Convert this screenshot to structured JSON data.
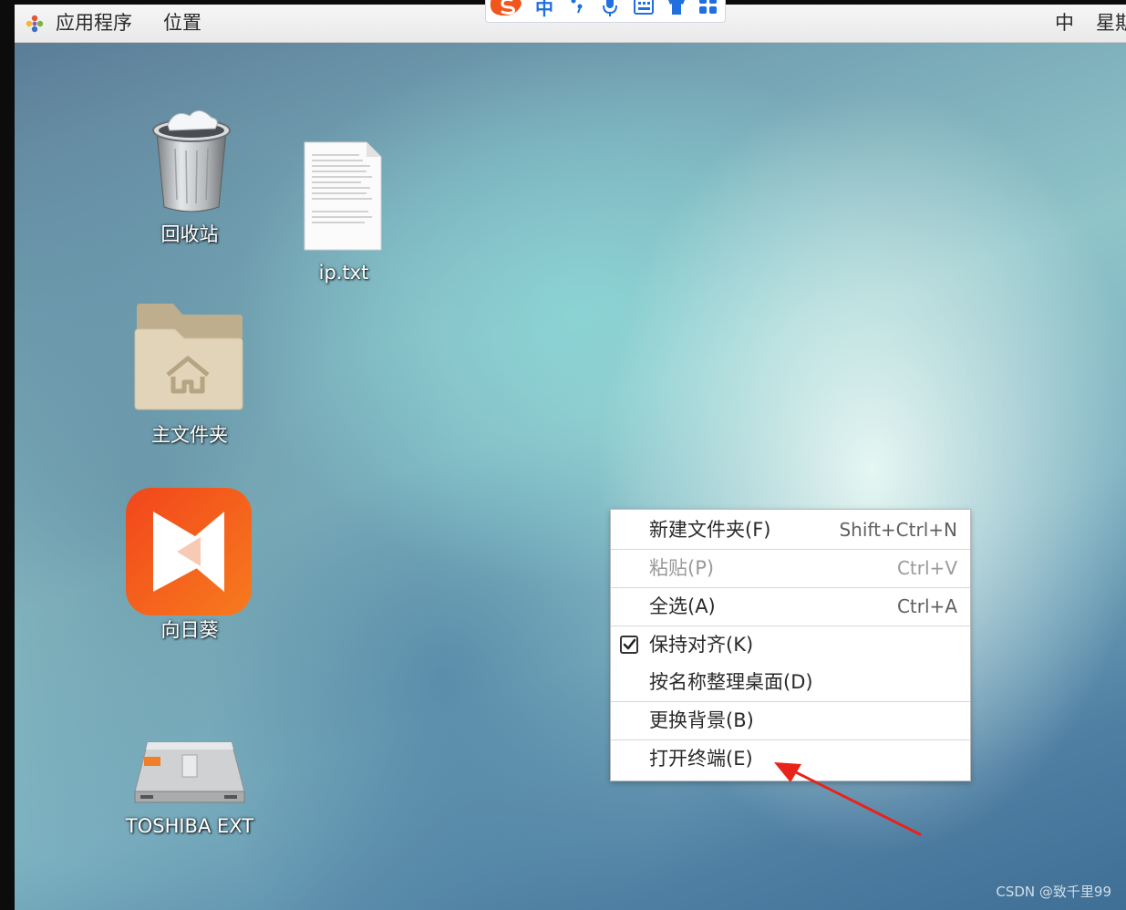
{
  "top_panel": {
    "applications_label": "应用程序",
    "places_label": "位置",
    "input_method_label": "中",
    "clock_label": "星期"
  },
  "ime_toolbar": {
    "mode_label": "中"
  },
  "desktop": {
    "icons": [
      {
        "label": "回收站",
        "icon": "trash-icon"
      },
      {
        "label": "ip.txt",
        "icon": "text-file-icon"
      },
      {
        "label": "主文件夹",
        "icon": "home-folder-icon"
      },
      {
        "label": "向日葵",
        "icon": "sunlogin-app-icon"
      },
      {
        "label": "TOSHIBA EXT",
        "icon": "external-drive-icon"
      }
    ]
  },
  "context_menu": {
    "items": [
      {
        "label": "新建文件夹(F)",
        "mnemonic": "F",
        "shortcut": "Shift+Ctrl+N",
        "enabled": true
      },
      {
        "label": "粘贴(P)",
        "mnemonic": "P",
        "shortcut": "Ctrl+V",
        "enabled": false
      },
      {
        "label": "全选(A)",
        "mnemonic": "A",
        "shortcut": "Ctrl+A",
        "enabled": true
      },
      {
        "label": "保持对齐(K)",
        "mnemonic": "K",
        "shortcut": "",
        "enabled": true,
        "checked": true
      },
      {
        "label": "按名称整理桌面(D)",
        "mnemonic": "D",
        "shortcut": "",
        "enabled": true
      },
      {
        "label": "更换背景(B)",
        "mnemonic": "B",
        "shortcut": "",
        "enabled": true
      },
      {
        "label": "打开终端(E)",
        "mnemonic": "E",
        "shortcut": "",
        "enabled": true
      }
    ]
  },
  "watermark": "CSDN @致千里99",
  "colors": {
    "annotation_arrow": "#e8231a",
    "sunlogin_orange": "#f2561d"
  }
}
